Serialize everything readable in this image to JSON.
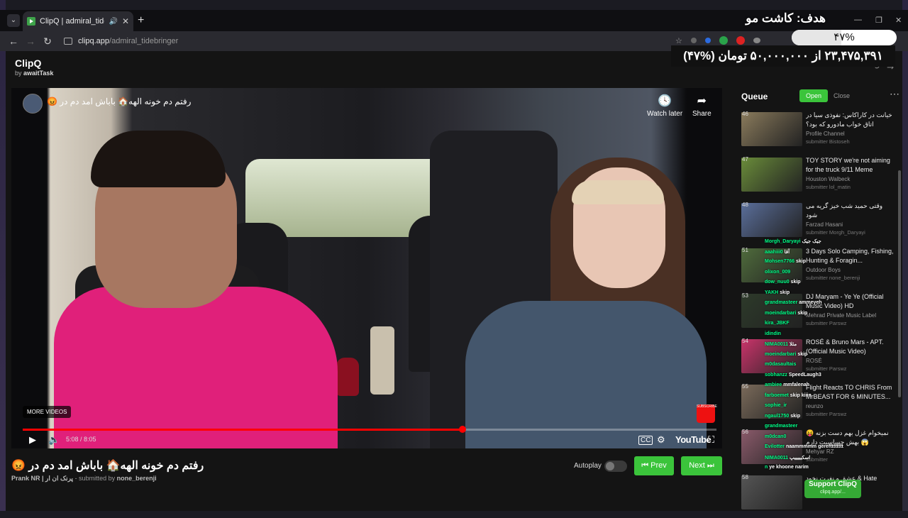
{
  "browser": {
    "tab_title": "ClipQ | admiral_tidebringer",
    "url_host": "clipq.app",
    "url_path": "/admiral_tidebringer"
  },
  "donation_overlay": {
    "goal": "هدف: کاشت مو",
    "percent_label": "۴۷%",
    "percent_value": 47,
    "amount_text": "۲۳,۴۷۵,۳۹۱ از ۵۰,۰۰۰,۰۰۰ تومان (%۴۷)"
  },
  "app": {
    "name": "ClipQ",
    "by_prefix": "by",
    "by_name": "awaitTask"
  },
  "player": {
    "video_title": "رفتم دم خونه الهه🏠 باباش امد دم در 😡",
    "watch_later": "Watch later",
    "share": "Share",
    "more_videos": "MORE VIDEOS",
    "subscribe": "SUBSCRIBE",
    "time": "5:08 / 8:05",
    "progress_fraction": 0.634,
    "youtube_logo": "YouTube"
  },
  "now_playing": {
    "title": "رفتم دم خونه الهه🏠 باباش امد دم در 😡",
    "channel": "Prank NR | پرنک ان ار",
    "submitted_prefix": "- submitted by",
    "submitter": "none_berenji",
    "autoplay_label": "Autoplay",
    "autoplay_on": false,
    "prev_label": "Prev",
    "next_label": "Next"
  },
  "queue": {
    "title": "Queue",
    "open_label": "Open",
    "close_label": "Close",
    "items": [
      {
        "num": "46",
        "title": "خیانت در کاراکاس: نفوذی سیا در اتاق خواب مادورو که بود؟",
        "channel": "Profile Channel",
        "submitter": "submitter Bistoseh",
        "color": "#8a7b5c"
      },
      {
        "num": "47",
        "title": "TOY STORY we're not aiming for the truck 9/11 Meme",
        "channel": "Houston Walbeck",
        "submitter": "submitter lol_matin",
        "color": "#6a8c3a"
      },
      {
        "num": "48",
        "title": "وقتی حمید شب خیز گریه می شود",
        "channel": "Farzad Hasani",
        "submitter": "submitter Morgh_Daryayi",
        "color": "#5a6e9a"
      },
      {
        "num": "51",
        "title": "3 Days Solo Camping, Fishing, Hunting & Foragin...",
        "channel": "Outdoor Boys",
        "submitter": "submitter none_berenji",
        "color": "#4f6b3c"
      },
      {
        "num": "53",
        "title": "DJ Maryam - Ye Ye (Official Music Video) HD",
        "channel": "Mehrad Private Music Label",
        "submitter": "submitter Parswz",
        "color": "#2d3a2a"
      },
      {
        "num": "54",
        "title": "ROSÉ & Bruno Mars - APT. (Official Music Video)",
        "channel": "ROSÉ",
        "submitter": "submitter Parswz",
        "color": "#c9346a"
      },
      {
        "num": "55",
        "title": "Flight Reacts TO CHRIS From MrBEAST FOR 6 MINUTES...",
        "channel": "reunzo",
        "submitter": "submitter Parswz",
        "color": "#7a6a5a"
      },
      {
        "num": "56",
        "title": "نمیخوام غزل بهم دست بزنه 😝 بهش حساسیت دارم 😱",
        "channel": "Mehyar RZ",
        "submitter": "submitter",
        "color": "#8a5a6a"
      },
      {
        "num": "58",
        "title": "عشق و نفرت نخود & Hate",
        "channel": "",
        "submitter": "",
        "color": "#555"
      }
    ]
  },
  "chat": [
    {
      "user": "Morgh_Daryayi",
      "text": "جیک جیک"
    },
    {
      "user": "aaahiii0",
      "text": "آقا"
    },
    {
      "user": "Mohsen7766",
      "text": "skip"
    },
    {
      "user": "olixon_009",
      "text": ""
    },
    {
      "user": "dow_nuu0",
      "text": "skip"
    },
    {
      "user": "YAKH",
      "text": "skip"
    },
    {
      "user": "grandmasteer",
      "text": "ammeyeh"
    },
    {
      "user": "moeindarbari",
      "text": "skip"
    },
    {
      "user": "kira_JBKF",
      "text": ""
    },
    {
      "user": "idindin",
      "text": ""
    },
    {
      "user": "NIMA0011",
      "text": "مثلا"
    },
    {
      "user": "moeindarbari",
      "text": "skip"
    },
    {
      "user": "m0dasaultais",
      "text": ""
    },
    {
      "user": "sobhanzz",
      "text": "SpeedLaugh3"
    },
    {
      "user": "ambiee",
      "text": "mmfalenah"
    },
    {
      "user": "farboemet",
      "text": "skip kiiin"
    },
    {
      "user": "sophie_ir",
      "text": ""
    },
    {
      "user": "ngaul1750",
      "text": "skip"
    },
    {
      "user": "grandmasteer",
      "text": ""
    },
    {
      "user": "m0dcan0",
      "text": ""
    },
    {
      "user": "Evilotter",
      "text": "naammmmm gereftttttttt"
    },
    {
      "user": "NIMA0011",
      "text": "اسکیییییپ"
    },
    {
      "user": "n",
      "text": "ye khoone narim"
    }
  ],
  "support": {
    "label": "Support ClipQ",
    "sub": "clipq.app/..."
  }
}
